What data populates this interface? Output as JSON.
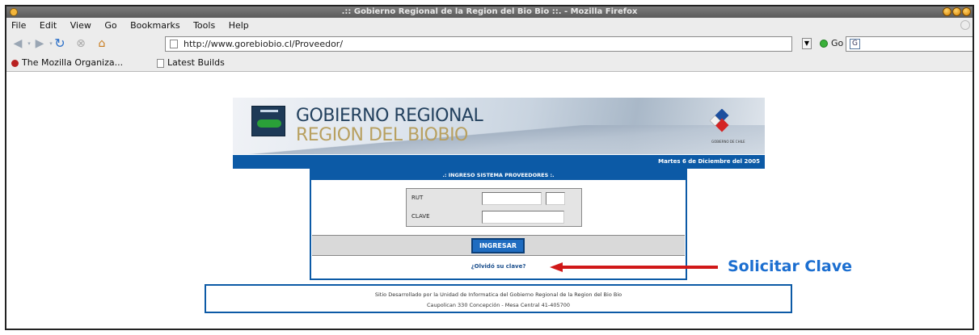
{
  "window": {
    "title": ".:: Gobierno Regional de la Region del Bio Bio ::. - Mozilla Firefox"
  },
  "menu": {
    "items": [
      "File",
      "Edit",
      "View",
      "Go",
      "Bookmarks",
      "Tools",
      "Help"
    ]
  },
  "nav": {
    "url": "http://www.gorebiobio.cl/Proveedor/",
    "go_label": "Go"
  },
  "bookmarks": {
    "items": [
      "The Mozilla Organiza...",
      "Latest Builds"
    ]
  },
  "page": {
    "banner_line1": "GOBIERNO REGIONAL",
    "banner_line2": "REGION DEL BIOBIO",
    "emblem_text": "GOBIERNO DE CHILE",
    "date_text": "Martes 6 de Diciembre del 2005",
    "login_header": ".: INGRESO SISTEMA PROVEEDORES :.",
    "rut_label": "RUT",
    "clave_label": "CLAVE",
    "submit_label": "INGRESAR",
    "forgot_link": "¿Olvidó su clave?",
    "footer_line1": "Sitio Desarrollado por la Unidad de Informatica del Gobierno Regional de la Region del Bio Bio",
    "footer_line2": "Caupolican 330 Concepción - Mesa Central 41-405700"
  },
  "annotation": {
    "label": "Solicitar Clave",
    "color": "#1b6ed0",
    "arrow_color": "#d01818"
  }
}
